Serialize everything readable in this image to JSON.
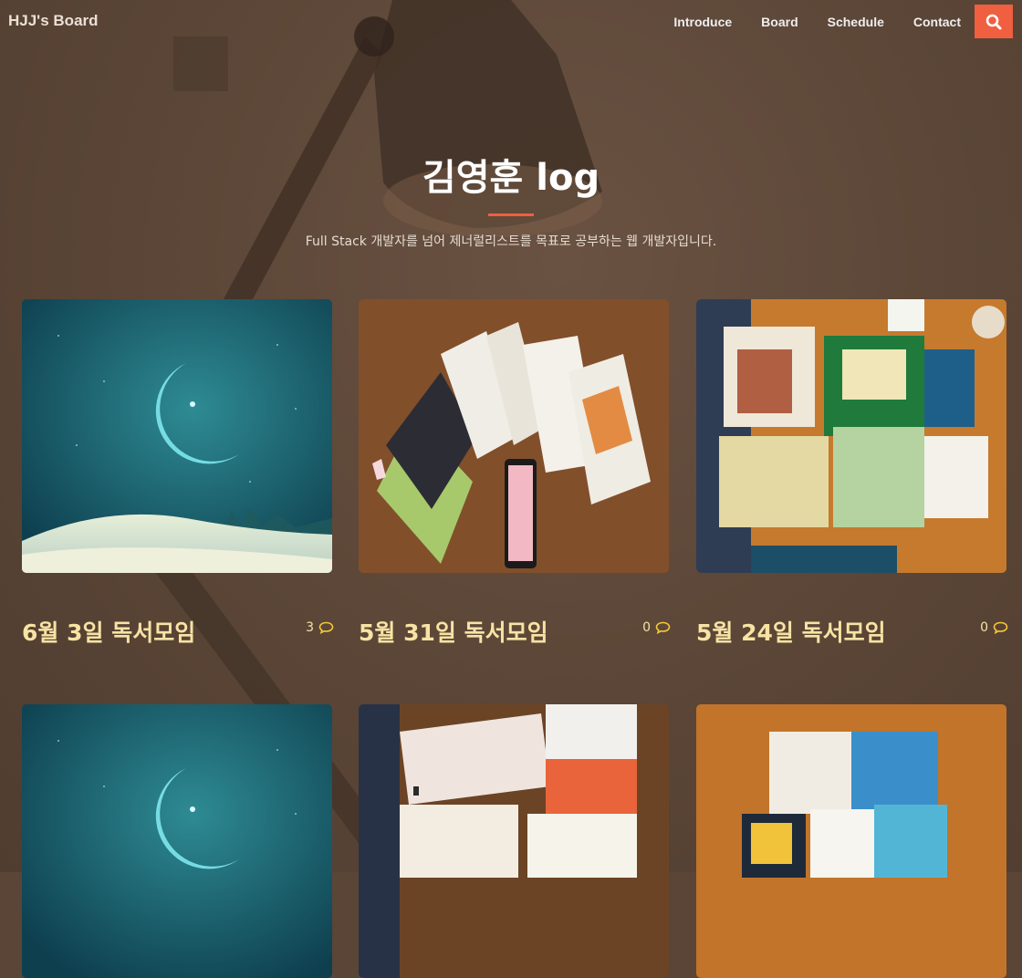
{
  "navbar": {
    "brand": "HJJ's Board",
    "links": [
      "Introduce",
      "Board",
      "Schedule",
      "Contact"
    ],
    "search_icon": "search-icon",
    "accent": "#f05f40"
  },
  "hero": {
    "title": "김영훈 log",
    "subtitle": "Full Stack 개발자를 넘어 제너럴리스트를 목표로 공부하는 웹 개발자입니다."
  },
  "posts": [
    {
      "title": "6월 3일 독서모임",
      "comments": "3",
      "image": "night-desert-moon"
    },
    {
      "title": "5월 31일 독서모임",
      "comments": "0",
      "image": "books-on-table-photo"
    },
    {
      "title": "5월 24일 독서모임",
      "comments": "0",
      "image": "books-on-table-photo"
    },
    {
      "title": "",
      "comments": "",
      "image": "night-desert-moon"
    },
    {
      "title": "",
      "comments": "",
      "image": "books-on-table-photo"
    },
    {
      "title": "",
      "comments": "",
      "image": "books-on-table-photo"
    }
  ],
  "colors": {
    "title": "#f7e3a4",
    "background": "#5a4536"
  }
}
